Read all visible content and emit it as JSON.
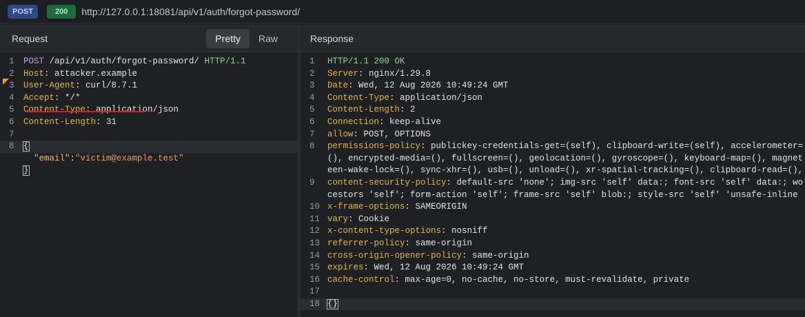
{
  "topbar": {
    "method": "POST",
    "status": "200",
    "url": "http://127.0.0.1:18081/api/v1/auth/forgot-password/"
  },
  "request": {
    "title": "Request",
    "toggle": [
      "Pretty",
      "Raw"
    ],
    "active_toggle": "Pretty",
    "lines": [
      {
        "n": "1",
        "parts": [
          [
            "method",
            "POST"
          ],
          [
            "path",
            " /api/v1/auth/forgot-password/ "
          ],
          [
            "ver",
            "HTTP/1.1"
          ]
        ]
      },
      {
        "n": "2",
        "parts": [
          [
            "hdr",
            "Host"
          ],
          [
            "txt",
            ": attacker.example"
          ]
        ]
      },
      {
        "n": "3",
        "parts": [
          [
            "hdr",
            "User-Agent"
          ],
          [
            "txt",
            ": curl/8.7.1"
          ]
        ]
      },
      {
        "n": "4",
        "parts": [
          [
            "hdr",
            "Accept"
          ],
          [
            "txt",
            ": */*"
          ]
        ]
      },
      {
        "n": "5",
        "parts": [
          [
            "hdr",
            "Content-Type"
          ],
          [
            "txt",
            ": application/json"
          ]
        ]
      },
      {
        "n": "6",
        "parts": [
          [
            "hdr",
            "Content-Length"
          ],
          [
            "txt",
            ": 31"
          ]
        ]
      },
      {
        "n": "7",
        "parts": []
      },
      {
        "n": "8",
        "parts": [
          [
            "brace",
            "{"
          ]
        ],
        "hl": true
      },
      {
        "n": "",
        "parts": [
          [
            "txt",
            "  "
          ],
          [
            "key",
            "\"email\""
          ],
          [
            "txt",
            ":"
          ],
          [
            "str",
            "\"victim@example.test\""
          ]
        ]
      },
      {
        "n": "",
        "parts": [
          [
            "brace",
            "}"
          ]
        ]
      }
    ]
  },
  "response": {
    "title": "Response",
    "lines": [
      {
        "n": "1",
        "parts": [
          [
            "status",
            "HTTP/1.1 200 OK"
          ]
        ]
      },
      {
        "n": "2",
        "parts": [
          [
            "hdr",
            "Server"
          ],
          [
            "txt",
            ": nginx/1.29.8"
          ]
        ]
      },
      {
        "n": "3",
        "parts": [
          [
            "hdr",
            "Date"
          ],
          [
            "txt",
            ": Wed, 12 Aug 2026 10:49:24 GMT"
          ]
        ]
      },
      {
        "n": "4",
        "parts": [
          [
            "hdr",
            "Content-Type"
          ],
          [
            "txt",
            ": application/json"
          ]
        ]
      },
      {
        "n": "5",
        "parts": [
          [
            "hdr",
            "Content-Length"
          ],
          [
            "txt",
            ": 2"
          ]
        ]
      },
      {
        "n": "6",
        "parts": [
          [
            "hdr",
            "Connection"
          ],
          [
            "txt",
            ": keep-alive"
          ]
        ]
      },
      {
        "n": "7",
        "parts": [
          [
            "hdr",
            "allow"
          ],
          [
            "txt",
            ": POST, OPTIONS"
          ]
        ]
      },
      {
        "n": "8",
        "parts": [
          [
            "hdr",
            "permissions-policy"
          ],
          [
            "txt",
            ": publickey-credentials-get=(self), clipboard-write=(self), accelerometer="
          ]
        ]
      },
      {
        "n": "",
        "parts": [
          [
            "txt",
            "(), encrypted-media=(), fullscreen=(), geolocation=(), gyroscope=(), keyboard-map=(), magnet"
          ]
        ]
      },
      {
        "n": "",
        "parts": [
          [
            "txt",
            "een-wake-lock=(), sync-xhr=(), usb=(), unload=(), xr-spatial-tracking=(), clipboard-read=(),"
          ]
        ]
      },
      {
        "n": "9",
        "parts": [
          [
            "hdr",
            "content-security-policy"
          ],
          [
            "txt",
            ": default-src 'none'; img-src 'self' data:; font-src 'self' data:; wo"
          ]
        ]
      },
      {
        "n": "",
        "parts": [
          [
            "txt",
            "cestors 'self'; form-action 'self'; frame-src 'self' blob:; style-src 'self' 'unsafe-inline"
          ]
        ]
      },
      {
        "n": "10",
        "parts": [
          [
            "hdr",
            "x-frame-options"
          ],
          [
            "txt",
            ": SAMEORIGIN"
          ]
        ]
      },
      {
        "n": "11",
        "parts": [
          [
            "hdr",
            "vary"
          ],
          [
            "txt",
            ": Cookie"
          ]
        ]
      },
      {
        "n": "12",
        "parts": [
          [
            "hdr",
            "x-content-type-options"
          ],
          [
            "txt",
            ": nosniff"
          ]
        ]
      },
      {
        "n": "13",
        "parts": [
          [
            "hdr",
            "referrer-policy"
          ],
          [
            "txt",
            ": same-origin"
          ]
        ]
      },
      {
        "n": "14",
        "parts": [
          [
            "hdr",
            "cross-origin-opener-policy"
          ],
          [
            "txt",
            ": same-origin"
          ]
        ]
      },
      {
        "n": "15",
        "parts": [
          [
            "hdr",
            "expires"
          ],
          [
            "txt",
            ": Wed, 12 Aug 2026 10:49:24 GMT"
          ]
        ]
      },
      {
        "n": "16",
        "parts": [
          [
            "hdr",
            "cache-control"
          ],
          [
            "txt",
            ": max-age=0, no-cache, no-store, must-revalidate, private"
          ]
        ]
      },
      {
        "n": "17",
        "parts": []
      },
      {
        "n": "18",
        "parts": [
          [
            "brace",
            "{}"
          ]
        ],
        "hl": true
      }
    ]
  }
}
